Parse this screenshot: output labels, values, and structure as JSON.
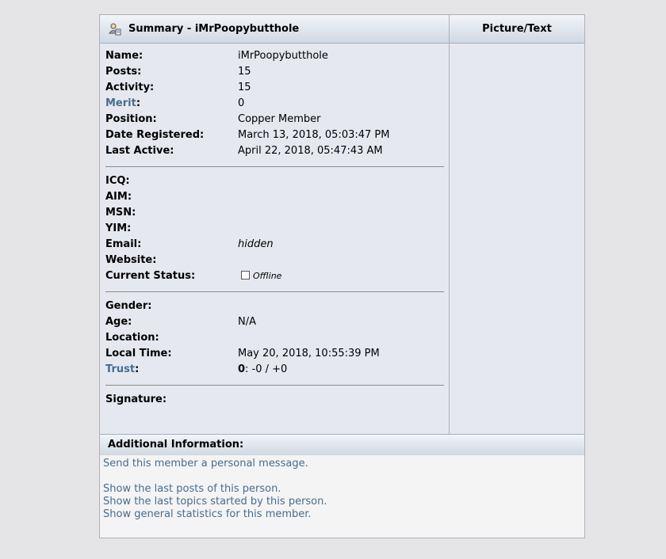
{
  "header": {
    "summary_title": "Summary - iMrPoopybutthole",
    "picture_title": "Picture/Text"
  },
  "profile": {
    "name_label": "Name:",
    "name_value": "iMrPoopybutthole",
    "posts_label": "Posts:",
    "posts_value": "15",
    "activity_label": "Activity:",
    "activity_value": "15",
    "merit_label": "Merit",
    "merit_colon": ":",
    "merit_value": "0",
    "position_label": "Position:",
    "position_value": "Copper Member",
    "date_registered_label": "Date Registered:",
    "date_registered_value": "March 13, 2018, 05:03:47 PM",
    "last_active_label": "Last Active:",
    "last_active_value": "April 22, 2018, 05:47:43 AM"
  },
  "contact": {
    "icq_label": "ICQ:",
    "aim_label": "AIM:",
    "msn_label": "MSN:",
    "yim_label": "YIM:",
    "email_label": "Email:",
    "email_value": "hidden",
    "website_label": "Website:",
    "status_label": "Current Status:",
    "status_value": "Offline"
  },
  "personal": {
    "gender_label": "Gender:",
    "age_label": "Age:",
    "age_value": "N/A",
    "location_label": "Location:",
    "local_time_label": "Local Time:",
    "local_time_value": "May 20, 2018, 10:55:39 PM",
    "trust_label": "Trust",
    "trust_colon": ":",
    "trust_score": "0",
    "trust_detail": ": -0 / +0"
  },
  "signature": {
    "label": "Signature:"
  },
  "additional": {
    "title": "Additional Information:",
    "send_pm": "Send this member a personal message.",
    "last_posts": "Show the last posts of this person.",
    "last_topics": "Show the last topics started by this person.",
    "stats": "Show general statistics for this member."
  },
  "colors": {
    "link": "#476c8e",
    "panel_bg": "#e6e8ef",
    "page_bg": "#e5e5e8"
  }
}
